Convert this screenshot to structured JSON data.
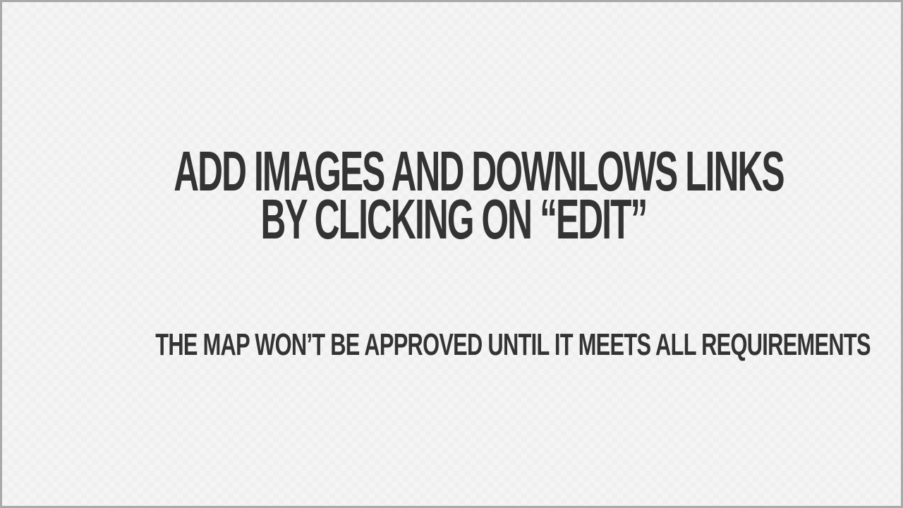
{
  "slide": {
    "headline_line1": "ADD IMAGES AND DOWNLOWS LINKS",
    "headline_line2": "BY CLICKING ON “EDIT”",
    "subline": "THE MAP WON’T BE APPROVED UNTIL IT MEETS ALL REQUIREMENTS"
  }
}
